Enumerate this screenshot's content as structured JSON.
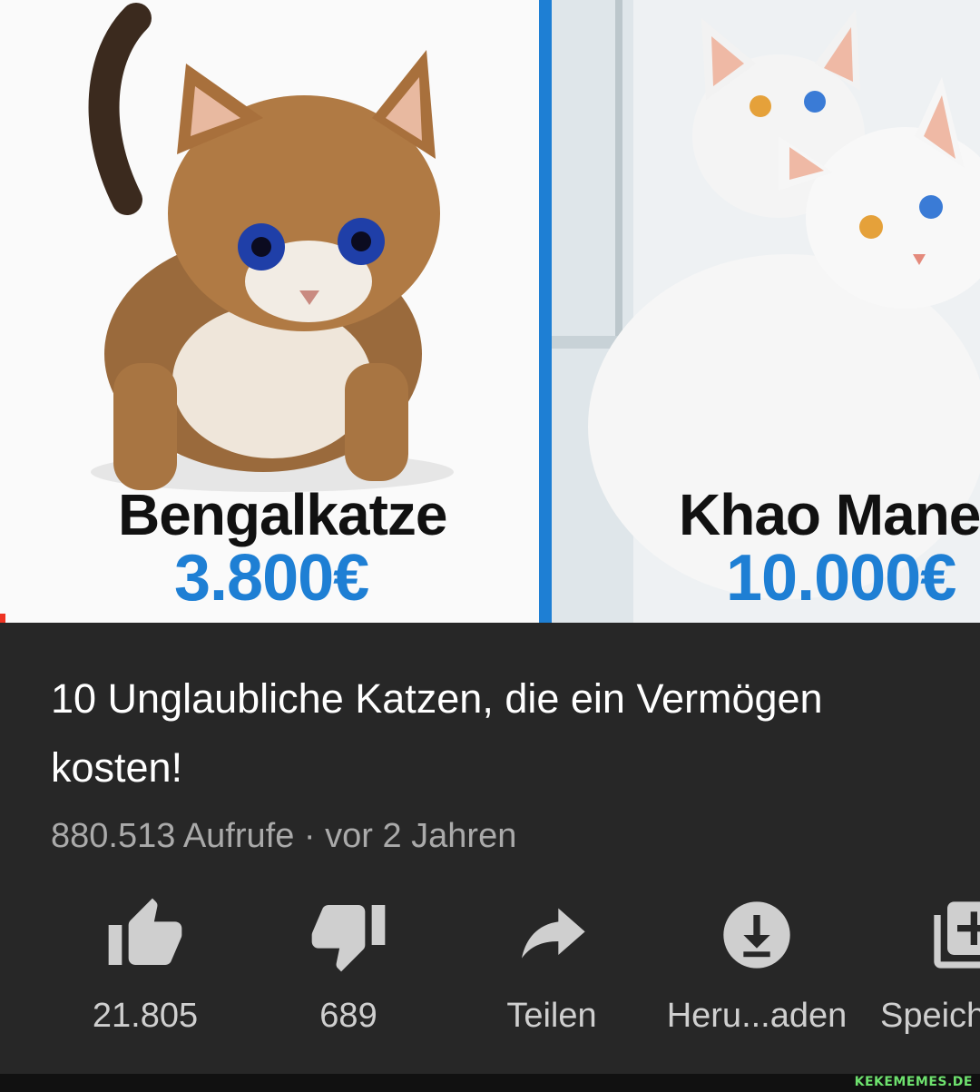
{
  "thumbnail": {
    "left": {
      "breed": "Bengalkatze",
      "price": "3.800€"
    },
    "right": {
      "breed": "Khao Mane",
      "price": "10.000€"
    },
    "accent": "#1e7fd4"
  },
  "video": {
    "title": "10 Unglaubliche Katzen, die ein Vermögen kosten!",
    "meta": "880.513 Aufrufe · vor 2 Jahren"
  },
  "actions": [
    {
      "icon": "thumbs-up-icon",
      "label": "21.805"
    },
    {
      "icon": "thumbs-down-icon",
      "label": "689"
    },
    {
      "icon": "share-icon",
      "label": "Teilen"
    },
    {
      "icon": "download-icon",
      "label": "Heru...aden"
    },
    {
      "icon": "save-playlist-icon",
      "label": "Speich"
    }
  ],
  "watermark": "KEKEMEMES.DE"
}
